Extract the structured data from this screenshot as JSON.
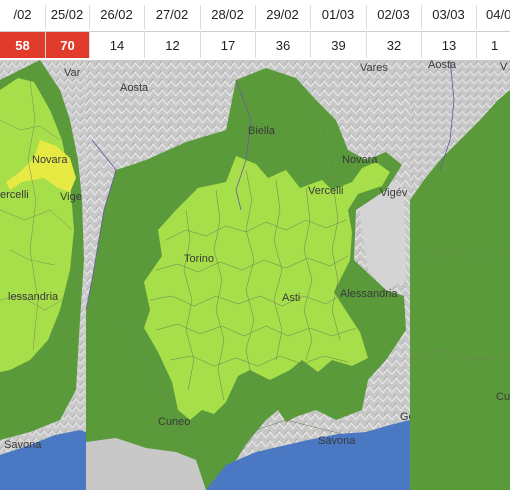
{
  "dates": [
    "/02",
    "25/02",
    "26/02",
    "27/02",
    "28/02",
    "29/02",
    "01/03",
    "02/03",
    "03/03",
    "04/0"
  ],
  "values": [
    "58",
    "70",
    "14",
    "12",
    "17",
    "36",
    "39",
    "32",
    "13",
    "1"
  ],
  "highlighted_days": [
    "58",
    "70"
  ],
  "colors": {
    "alert_red": "#e03b2b",
    "level_low_dark_green": "#5a9a3b",
    "level_medium_light_green": "#a6df49",
    "level_high_yellow": "#e8ea44",
    "sea_blue": "#4a78c2",
    "relief_grey": "#c8c8c8"
  },
  "maps": {
    "left": {
      "labels": {
        "varese": "Var",
        "novara": "Novara",
        "vercelli": "ercelli",
        "vigevano": "Vige",
        "alessandria": "lessandria",
        "savona": "Savona"
      }
    },
    "center": {
      "labels": {
        "aosta": "Aosta",
        "biella": "Biella",
        "varese": "Vares",
        "novara": "Novara",
        "vercelli": "Vercelli",
        "vigevano": "Vigév",
        "torino": "Torino",
        "asti": "Asti",
        "alessandria": "Alessandria",
        "cuneo": "Cuneo",
        "savona": "Savona",
        "genova": "Ge"
      }
    },
    "right": {
      "labels": {
        "aosta": "Aosta",
        "varese": "V",
        "cuneo": "Cu"
      }
    }
  }
}
